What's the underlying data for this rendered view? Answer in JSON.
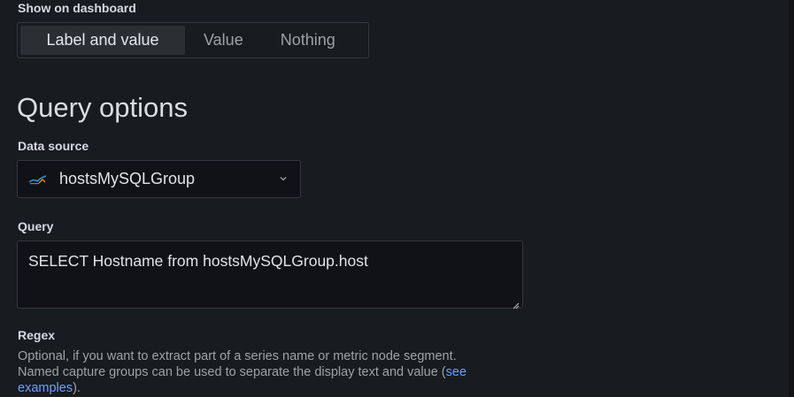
{
  "display": {
    "label": "Show on dashboard",
    "options": [
      "Label and value",
      "Value",
      "Nothing"
    ],
    "selected": "Label and value"
  },
  "query_options": {
    "title": "Query options",
    "data_source": {
      "label": "Data source",
      "value": "hostsMySQLGroup",
      "icon": "mysql-datasource-icon"
    },
    "query": {
      "label": "Query",
      "value": "SELECT Hostname from hostsMySQLGroup.host"
    },
    "regex": {
      "label": "Regex",
      "description_line1": "Optional, if you want to extract part of a series name or metric node segment.",
      "description_line2_prefix": "Named capture groups can be used to separate the display text and value (",
      "link_text_1": "see",
      "link_text_2": "examples",
      "description_suffix": ")."
    }
  },
  "colors": {
    "background": "#181b1f",
    "input_background": "#111217",
    "border": "#34373d",
    "link": "#6e9fff"
  }
}
